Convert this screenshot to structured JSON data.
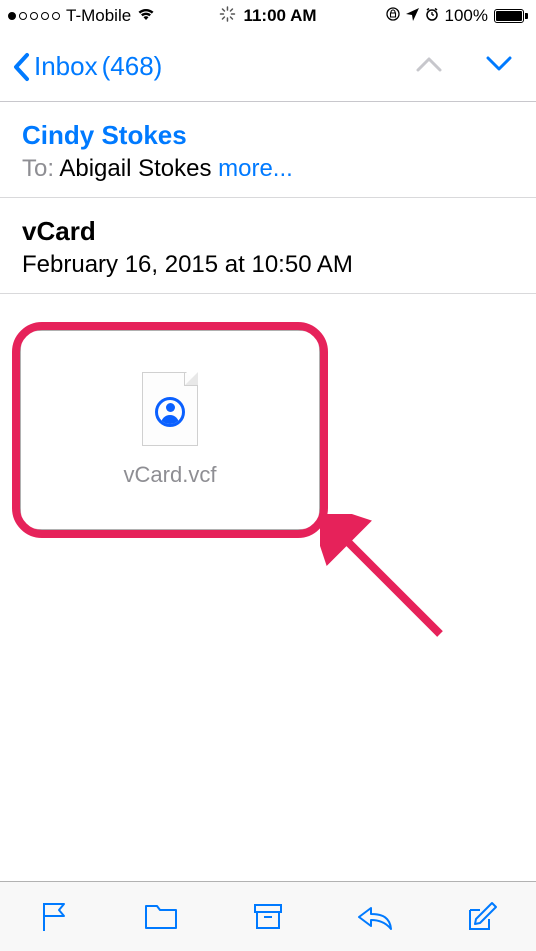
{
  "statusBar": {
    "carrier": "T-Mobile",
    "time": "11:00 AM",
    "batteryPct": "100%"
  },
  "nav": {
    "backLabel": "Inbox",
    "backCount": "(468)"
  },
  "message": {
    "sender": "Cindy Stokes",
    "toLabel": "To:",
    "recipient": "Abigail Stokes",
    "moreLabel": "more...",
    "subject": "vCard",
    "date": "February 16, 2015 at 10:50 AM"
  },
  "attachment": {
    "filename": "vCard.vcf"
  },
  "colors": {
    "accent": "#007aff",
    "highlight": "#e6225a"
  }
}
